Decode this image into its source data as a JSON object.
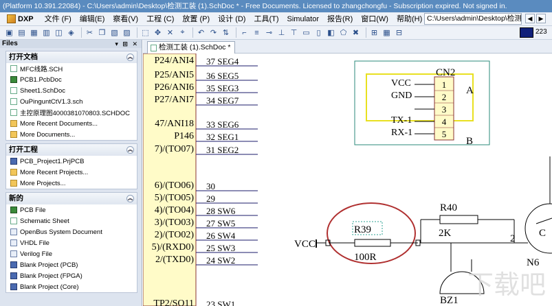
{
  "window": {
    "title": "(Platform 10.391.22084) - C:\\Users\\admin\\Desktop\\检测工装 (1).SchDoc * - Free Documents. Licensed to zhangchongfu - Subscription expired. Not signed in."
  },
  "menubar": {
    "brand": "DXP",
    "items": [
      "文件 (F)",
      "编辑(E)",
      "察看(V)",
      "工程 (C)",
      "放置 (P)",
      "设计 (D)",
      "工具(T)",
      "Simulator",
      "报告(R)",
      "窗口(W)",
      "帮助(H)"
    ],
    "path_value": "C:\\Users\\admin\\Desktop\\检测工"
  },
  "toolbar": {
    "zoom_value": "223",
    "buttons": [
      "open-icon",
      "save-icon",
      "print-icon",
      "preview-icon",
      "cut-icon",
      "copy-icon",
      "paste-icon",
      "rubber-stamp-icon",
      "select-area-icon",
      "move-icon",
      "deselect-icon",
      "cross-probe-icon",
      "undo-icon",
      "redo-icon",
      "hierarchy-icon",
      "wire-icon",
      "bus-icon",
      "net-label-icon",
      "power-port-icon",
      "part-icon",
      "sheet-symbol-icon",
      "port-icon",
      "no-erc-icon",
      "align-icon",
      "grid-icon"
    ]
  },
  "panel": {
    "title": "Files",
    "sections": [
      {
        "title": "打开文档",
        "items": [
          {
            "label": "MFC线路.SCH",
            "icon": "sch"
          },
          {
            "label": "PCB1.PcbDoc",
            "icon": "pcb"
          },
          {
            "label": "Sheet1.SchDoc",
            "icon": "sch"
          },
          {
            "label": "OuPinguntCtV1.3.sch",
            "icon": "sch"
          },
          {
            "label": "主控原理图4000381070803.SCHDOC",
            "icon": "sch"
          },
          {
            "label": "More Recent Documents...",
            "icon": "folder"
          },
          {
            "label": "More Documents...",
            "icon": "folder"
          }
        ]
      },
      {
        "title": "打开工程",
        "items": [
          {
            "label": "PCB_Project1.PrjPCB",
            "icon": "prj"
          },
          {
            "label": "More Recent Projects...",
            "icon": "folder"
          },
          {
            "label": "More Projects...",
            "icon": "folder"
          }
        ]
      },
      {
        "title": "新的",
        "items": [
          {
            "label": "PCB File",
            "icon": "pcb"
          },
          {
            "label": "Schematic Sheet",
            "icon": "sch"
          },
          {
            "label": "OpenBus System Document",
            "icon": "doc"
          },
          {
            "label": "VHDL File",
            "icon": "doc"
          },
          {
            "label": "Verilog File",
            "icon": "doc"
          },
          {
            "label": "Blank Project (PCB)",
            "icon": "prj"
          },
          {
            "label": "Blank Project (FPGA)",
            "icon": "prj"
          },
          {
            "label": "Blank Project (Core)",
            "icon": "prj"
          }
        ]
      }
    ]
  },
  "document_tab": {
    "label": "检测工装 (1).SchDoc *"
  },
  "schematic": {
    "ic_pins_left": [
      "P24/ANI4",
      "P25/ANI5",
      "P26/ANI6",
      "P27/ANI7",
      "47/ANI18",
      "P146",
      "7)/(TO07)",
      "6)/(TO06)",
      "5)/(TO05)",
      "4)/(TO04)",
      "3)/(TO03)",
      "2)/(TO02)",
      "5)/(RXD0)",
      "2/(TXD0)",
      "TP2/SO11"
    ],
    "pin_nets": [
      "37 SEG4",
      "36 SEG5",
      "35 SEG3",
      "34 SEG7",
      "33 SEG6",
      "32 SEG1",
      "31 SEG2",
      "30",
      "29",
      "28 SW6",
      "27 SW5",
      "26 SW4",
      "25 SW3",
      "24 SW2",
      "23 SW1"
    ],
    "connector": {
      "ref": "CN2",
      "signals": [
        "VCC",
        "GND",
        "",
        "TX-1",
        "RX-1"
      ],
      "pins": [
        "1",
        "2",
        "3",
        "4",
        "5"
      ],
      "label_a": "A",
      "label_b": "B"
    },
    "resistor_r39": {
      "ref": "R39",
      "value": "100R",
      "net_left": "VCC"
    },
    "resistor_r40": {
      "ref": "R40",
      "value": "2K"
    },
    "node_label": "2",
    "transistor": {
      "ref": "N6",
      "pin": "C"
    },
    "buzzer": {
      "ref": "BZ1"
    },
    "watermark": "下载吧"
  }
}
